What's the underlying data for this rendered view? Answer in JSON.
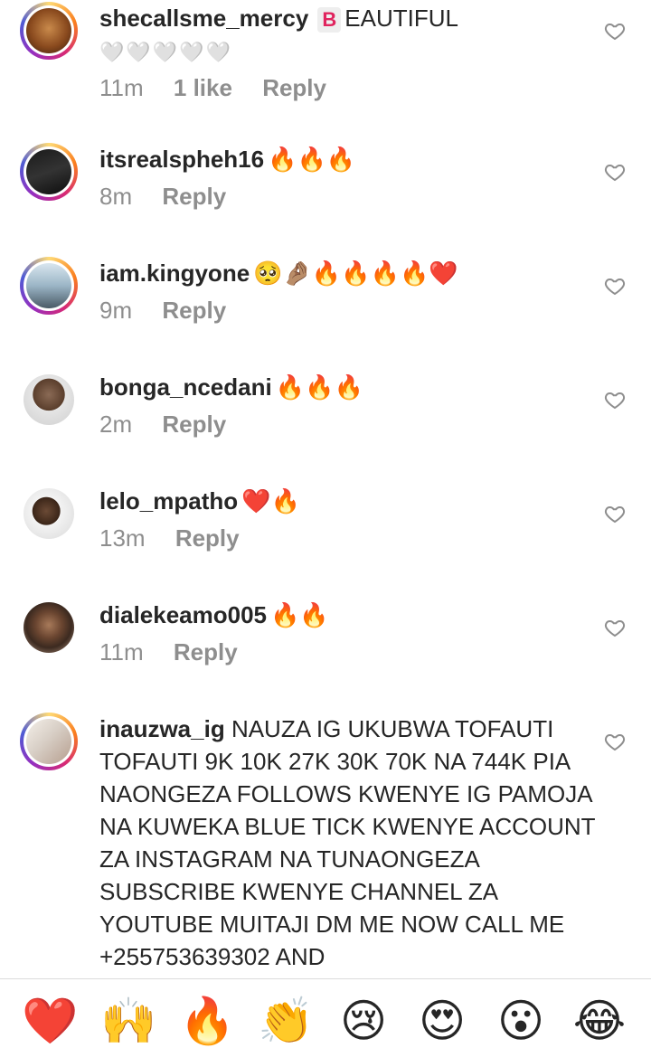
{
  "comments": [
    {
      "username": "shecallsme_mercy",
      "badge": "B",
      "text": "EAUTIFUL",
      "hearts": "🤍🤍🤍🤍🤍",
      "time": "11m",
      "likes": "1 like",
      "reply": "Reply"
    },
    {
      "username": "itsrealspheh16",
      "text": "🔥🔥🔥",
      "time": "8m",
      "reply": "Reply"
    },
    {
      "username": "iam.kingyone",
      "text": "🥺🤌🏽🔥🔥🔥🔥❤️",
      "time": "9m",
      "reply": "Reply"
    },
    {
      "username": "bonga_ncedani",
      "text": "🔥🔥🔥",
      "time": "2m",
      "reply": "Reply"
    },
    {
      "username": "lelo_mpatho",
      "text": "❤️🔥",
      "time": "13m",
      "reply": "Reply"
    },
    {
      "username": "dialekeamo005",
      "text": "🔥🔥",
      "time": "11m",
      "reply": "Reply"
    },
    {
      "username": "inauzwa_ig",
      "text": "NAUZA IG UKUBWA TOFAUTI TOFAUTI  9K 10K 27K 30K 70K NA 744K PIA NAONGEZA FOLLOWS KWENYE IG PAMOJA NA KUWEKA BLUE TICK KWENYE ACCOUNT ZA INSTAGRAM NA TUNAONGEZA SUBSCRIBE KWENYE CHANNEL ZA YOUTUBE MUITAJI DM ME NOW CALL ME +255753639302 AND"
    }
  ],
  "reactions": [
    "❤️",
    "🙌",
    "🔥",
    "👏",
    "😢",
    "😍",
    "😮",
    "😂"
  ],
  "colors": {
    "ring_start": "#feda75",
    "ring_end": "#962fbf",
    "secondary_text": "#8e8e8e",
    "heart_outline": "#8e8e8e"
  }
}
